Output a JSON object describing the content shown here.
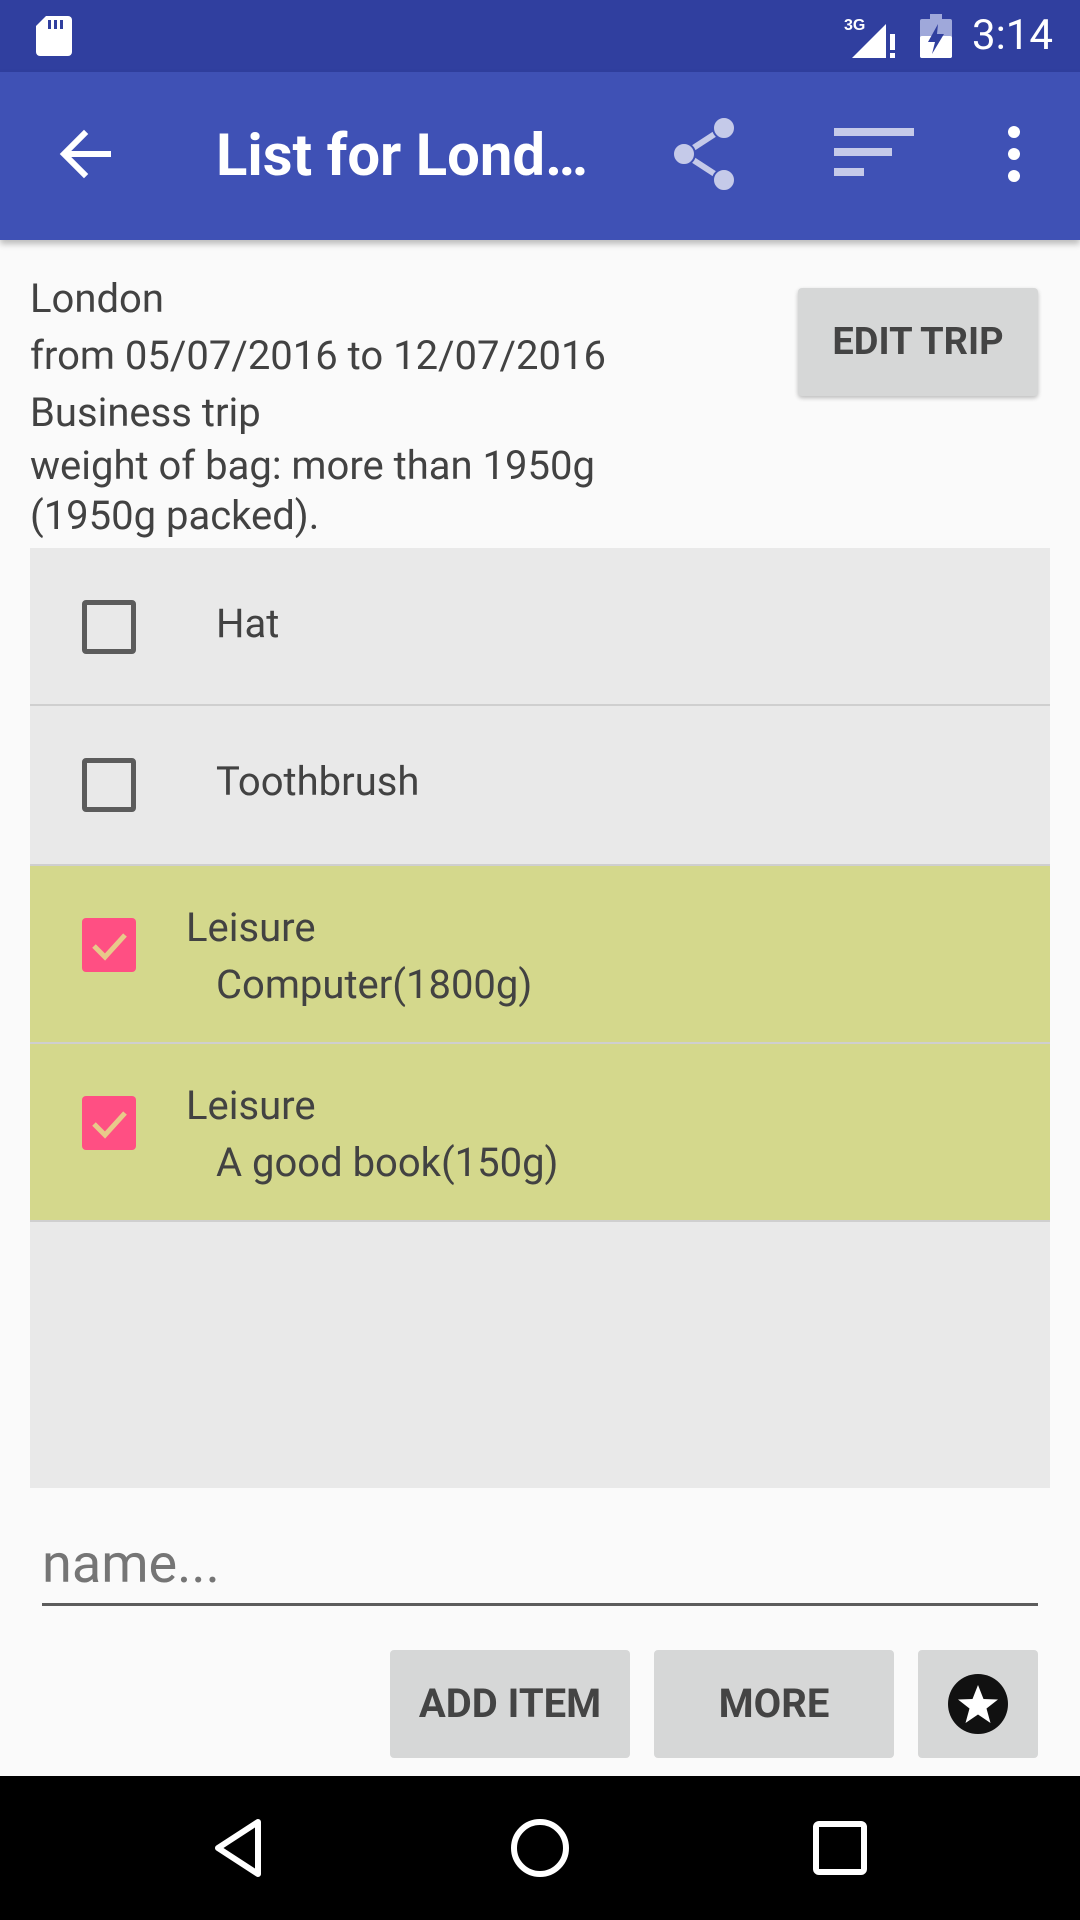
{
  "status_bar": {
    "time": "3:14",
    "network": "3G",
    "icons": [
      "sd-card-icon",
      "signal-icon",
      "battery-icon"
    ]
  },
  "app_bar": {
    "title": "List for London",
    "icons": [
      "back-arrow-icon",
      "share-icon",
      "sort-icon",
      "overflow-menu-icon"
    ]
  },
  "trip": {
    "destination": "London",
    "dates": "from 05/07/2016 to 12/07/2016",
    "type": "Business trip",
    "weight": "weight of bag: more than 1950g (1950g packed).",
    "edit_label": "EDIT TRIP"
  },
  "items": [
    {
      "label": "Hat",
      "checked": false
    },
    {
      "label": "Toothbrush",
      "checked": false
    },
    {
      "category": "Leisure",
      "label": "Computer(1800g)",
      "checked": true
    },
    {
      "category": "Leisure",
      "label": "A good book(150g)",
      "checked": true
    }
  ],
  "input": {
    "placeholder": "name...",
    "value": ""
  },
  "buttons": {
    "add": "ADD ITEM",
    "more": "MORE",
    "favorite_icon": "star-icon"
  },
  "colors": {
    "status_bar": "#303f9f",
    "app_bar": "#3f51b5",
    "checked_row": "#d4d88c",
    "checkbox_checked": "#ff4f83",
    "list_bg": "#e9e9e9"
  },
  "nav_bar": {
    "icons": [
      "back-triangle-icon",
      "home-circle-icon",
      "recents-square-icon"
    ]
  }
}
